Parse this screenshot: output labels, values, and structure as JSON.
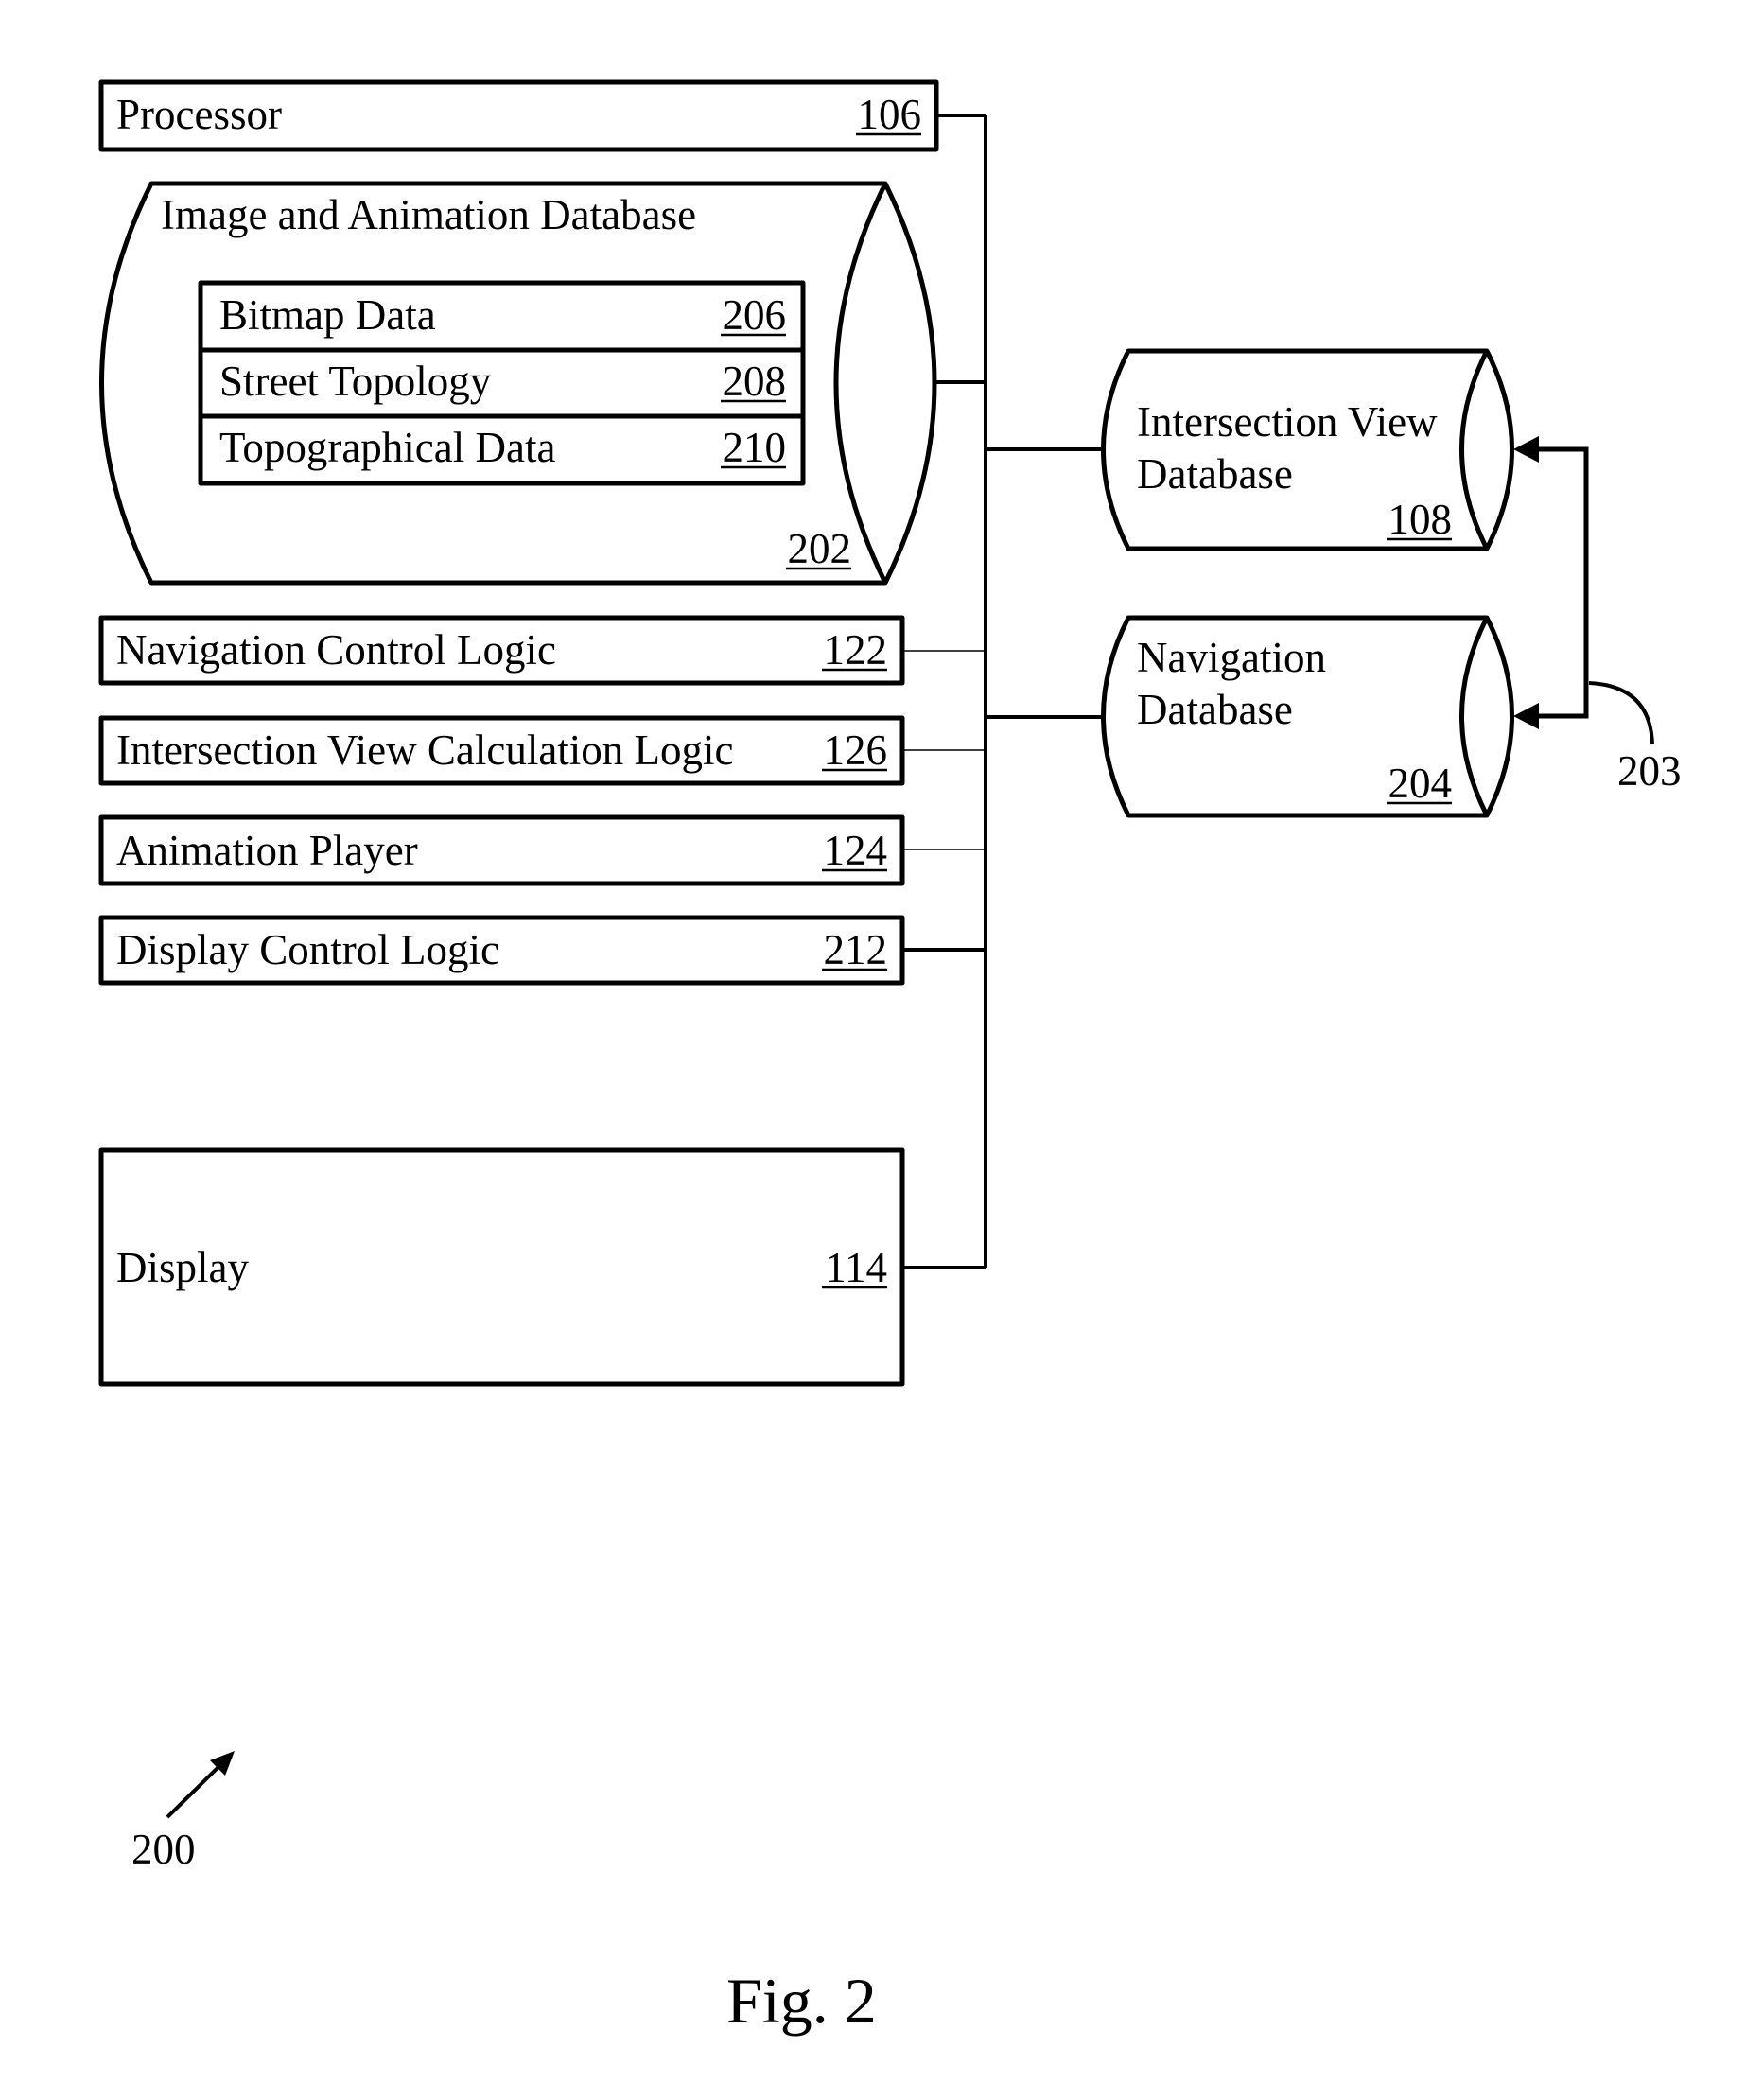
{
  "figure": {
    "caption": "Fig. 2",
    "reference": "200"
  },
  "components": {
    "processor": {
      "label": "Processor",
      "ref": "106"
    },
    "image_animation_db": {
      "label": "Image and Animation Database",
      "ref": "202",
      "entries": [
        {
          "label": "Bitmap Data",
          "ref": "206"
        },
        {
          "label": "Street Topology",
          "ref": "208"
        },
        {
          "label": "Topographical Data",
          "ref": "210"
        }
      ]
    },
    "navigation_control_logic": {
      "label": "Navigation Control Logic",
      "ref": "122"
    },
    "intersection_view_calc_logic": {
      "label": "Intersection View Calculation Logic",
      "ref": "126"
    },
    "animation_player": {
      "label": "Animation Player",
      "ref": "124"
    },
    "display_control_logic": {
      "label": "Display Control Logic",
      "ref": "212"
    },
    "display": {
      "label": "Display",
      "ref": "114"
    },
    "intersection_view_db": {
      "label_line1": "Intersection View",
      "label_line2": "Database",
      "ref": "108"
    },
    "navigation_db": {
      "label_line1": "Navigation",
      "label_line2": "Database",
      "ref": "204"
    },
    "link_ref": "203"
  }
}
